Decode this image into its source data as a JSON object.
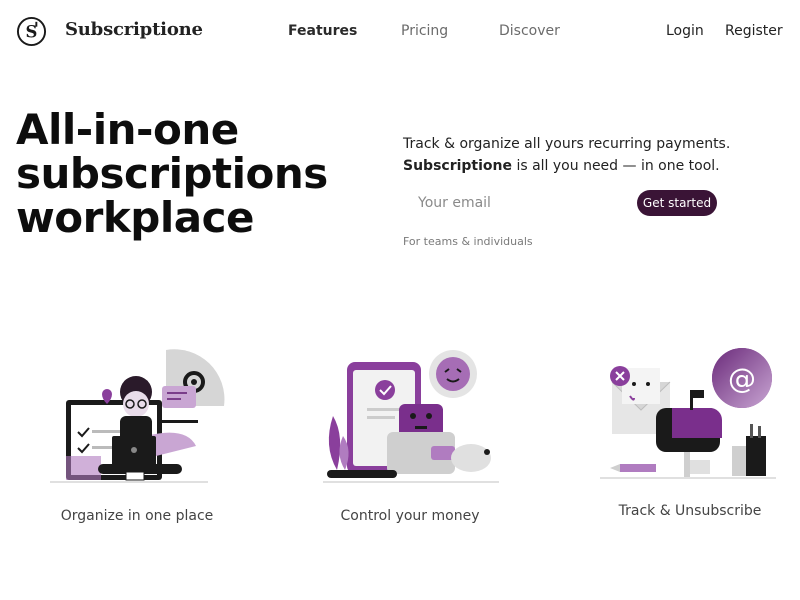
{
  "brand": {
    "name": "Subscriptione",
    "logo_letter": "S"
  },
  "nav": {
    "links": [
      {
        "label": "Features",
        "active": true
      },
      {
        "label": "Pricing",
        "active": false
      },
      {
        "label": "Discover",
        "active": false
      }
    ],
    "login": "Login",
    "register": "Register"
  },
  "hero": {
    "title_lines": [
      "All-in-one",
      "subscriptions",
      "workplace"
    ],
    "tagline_line1": "Track & organize all yours recurring payments.",
    "tagline_bold": "Subscriptione",
    "tagline_rest": " is all you need — in one tool.",
    "email_placeholder": "Your email",
    "cta_label": "Get started",
    "note": "For teams & individuals"
  },
  "features": [
    {
      "label": "Organize in one place",
      "icon": "person-with-laptop-illustration"
    },
    {
      "label": "Control your money",
      "icon": "phone-wallet-piggy-illustration"
    },
    {
      "label": "Track & Unsubscribe",
      "icon": "mail-unsubscribe-illustration"
    }
  ],
  "colors": {
    "accent": "#3a1436",
    "purple": "#8a3f9c",
    "light_purple": "#b07cc0",
    "gray": "#d9d9d9"
  }
}
